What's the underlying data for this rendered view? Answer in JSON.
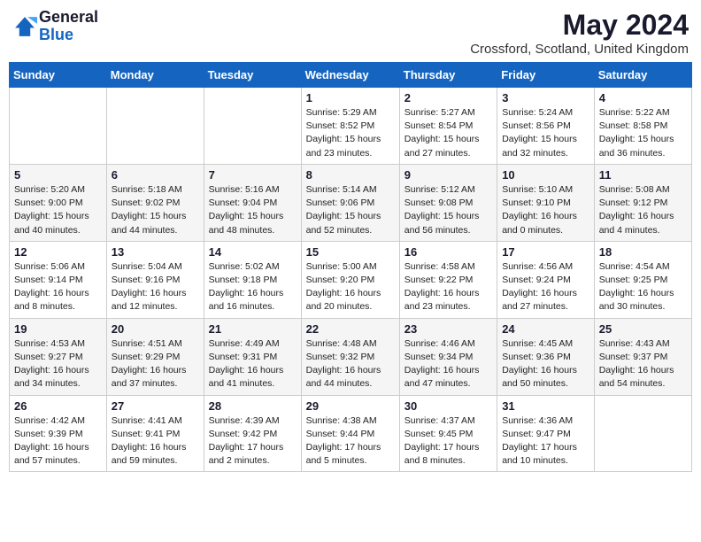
{
  "logo": {
    "general": "General",
    "blue": "Blue"
  },
  "title": "May 2024",
  "location": "Crossford, Scotland, United Kingdom",
  "weekdays": [
    "Sunday",
    "Monday",
    "Tuesday",
    "Wednesday",
    "Thursday",
    "Friday",
    "Saturday"
  ],
  "weeks": [
    [
      {
        "day": "",
        "info": ""
      },
      {
        "day": "",
        "info": ""
      },
      {
        "day": "",
        "info": ""
      },
      {
        "day": "1",
        "info": "Sunrise: 5:29 AM\nSunset: 8:52 PM\nDaylight: 15 hours\nand 23 minutes."
      },
      {
        "day": "2",
        "info": "Sunrise: 5:27 AM\nSunset: 8:54 PM\nDaylight: 15 hours\nand 27 minutes."
      },
      {
        "day": "3",
        "info": "Sunrise: 5:24 AM\nSunset: 8:56 PM\nDaylight: 15 hours\nand 32 minutes."
      },
      {
        "day": "4",
        "info": "Sunrise: 5:22 AM\nSunset: 8:58 PM\nDaylight: 15 hours\nand 36 minutes."
      }
    ],
    [
      {
        "day": "5",
        "info": "Sunrise: 5:20 AM\nSunset: 9:00 PM\nDaylight: 15 hours\nand 40 minutes."
      },
      {
        "day": "6",
        "info": "Sunrise: 5:18 AM\nSunset: 9:02 PM\nDaylight: 15 hours\nand 44 minutes."
      },
      {
        "day": "7",
        "info": "Sunrise: 5:16 AM\nSunset: 9:04 PM\nDaylight: 15 hours\nand 48 minutes."
      },
      {
        "day": "8",
        "info": "Sunrise: 5:14 AM\nSunset: 9:06 PM\nDaylight: 15 hours\nand 52 minutes."
      },
      {
        "day": "9",
        "info": "Sunrise: 5:12 AM\nSunset: 9:08 PM\nDaylight: 15 hours\nand 56 minutes."
      },
      {
        "day": "10",
        "info": "Sunrise: 5:10 AM\nSunset: 9:10 PM\nDaylight: 16 hours\nand 0 minutes."
      },
      {
        "day": "11",
        "info": "Sunrise: 5:08 AM\nSunset: 9:12 PM\nDaylight: 16 hours\nand 4 minutes."
      }
    ],
    [
      {
        "day": "12",
        "info": "Sunrise: 5:06 AM\nSunset: 9:14 PM\nDaylight: 16 hours\nand 8 minutes."
      },
      {
        "day": "13",
        "info": "Sunrise: 5:04 AM\nSunset: 9:16 PM\nDaylight: 16 hours\nand 12 minutes."
      },
      {
        "day": "14",
        "info": "Sunrise: 5:02 AM\nSunset: 9:18 PM\nDaylight: 16 hours\nand 16 minutes."
      },
      {
        "day": "15",
        "info": "Sunrise: 5:00 AM\nSunset: 9:20 PM\nDaylight: 16 hours\nand 20 minutes."
      },
      {
        "day": "16",
        "info": "Sunrise: 4:58 AM\nSunset: 9:22 PM\nDaylight: 16 hours\nand 23 minutes."
      },
      {
        "day": "17",
        "info": "Sunrise: 4:56 AM\nSunset: 9:24 PM\nDaylight: 16 hours\nand 27 minutes."
      },
      {
        "day": "18",
        "info": "Sunrise: 4:54 AM\nSunset: 9:25 PM\nDaylight: 16 hours\nand 30 minutes."
      }
    ],
    [
      {
        "day": "19",
        "info": "Sunrise: 4:53 AM\nSunset: 9:27 PM\nDaylight: 16 hours\nand 34 minutes."
      },
      {
        "day": "20",
        "info": "Sunrise: 4:51 AM\nSunset: 9:29 PM\nDaylight: 16 hours\nand 37 minutes."
      },
      {
        "day": "21",
        "info": "Sunrise: 4:49 AM\nSunset: 9:31 PM\nDaylight: 16 hours\nand 41 minutes."
      },
      {
        "day": "22",
        "info": "Sunrise: 4:48 AM\nSunset: 9:32 PM\nDaylight: 16 hours\nand 44 minutes."
      },
      {
        "day": "23",
        "info": "Sunrise: 4:46 AM\nSunset: 9:34 PM\nDaylight: 16 hours\nand 47 minutes."
      },
      {
        "day": "24",
        "info": "Sunrise: 4:45 AM\nSunset: 9:36 PM\nDaylight: 16 hours\nand 50 minutes."
      },
      {
        "day": "25",
        "info": "Sunrise: 4:43 AM\nSunset: 9:37 PM\nDaylight: 16 hours\nand 54 minutes."
      }
    ],
    [
      {
        "day": "26",
        "info": "Sunrise: 4:42 AM\nSunset: 9:39 PM\nDaylight: 16 hours\nand 57 minutes."
      },
      {
        "day": "27",
        "info": "Sunrise: 4:41 AM\nSunset: 9:41 PM\nDaylight: 16 hours\nand 59 minutes."
      },
      {
        "day": "28",
        "info": "Sunrise: 4:39 AM\nSunset: 9:42 PM\nDaylight: 17 hours\nand 2 minutes."
      },
      {
        "day": "29",
        "info": "Sunrise: 4:38 AM\nSunset: 9:44 PM\nDaylight: 17 hours\nand 5 minutes."
      },
      {
        "day": "30",
        "info": "Sunrise: 4:37 AM\nSunset: 9:45 PM\nDaylight: 17 hours\nand 8 minutes."
      },
      {
        "day": "31",
        "info": "Sunrise: 4:36 AM\nSunset: 9:47 PM\nDaylight: 17 hours\nand 10 minutes."
      },
      {
        "day": "",
        "info": ""
      }
    ]
  ]
}
